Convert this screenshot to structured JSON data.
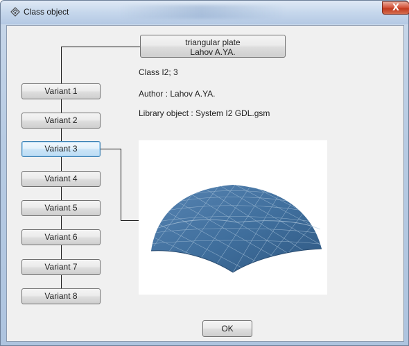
{
  "window": {
    "title": "Class object",
    "close_label": "X"
  },
  "header_button": {
    "line1": "triangular plate",
    "line2": "Lahov A.YA."
  },
  "variants": [
    "Variant 1",
    "Variant 2",
    "Variant 3",
    "Variant 4",
    "Variant 5",
    "Variant 6",
    "Variant 7",
    "Variant 8"
  ],
  "selected_variant": 3,
  "info": {
    "class_line": "Class I2; 3",
    "author_line": "Author : Lahov A.YA.",
    "library_line": "Library object : System I2 GDL.gsm"
  },
  "preview": {
    "icon": "dome-3d-preview",
    "surface_color": "#3f6e9c",
    "mesh_color": "#9fbbd4"
  },
  "ok_label": "OK"
}
